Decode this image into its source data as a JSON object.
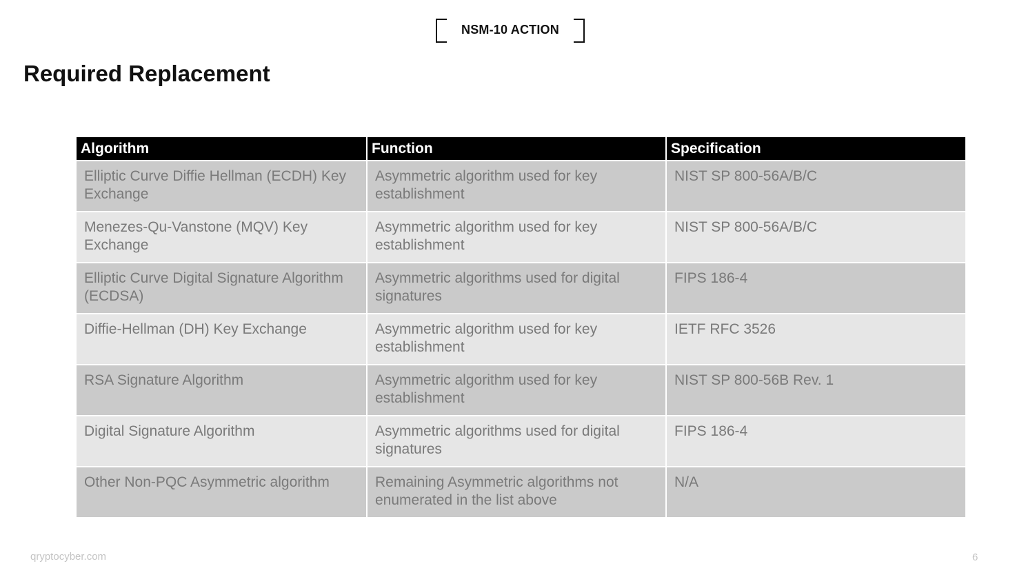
{
  "badge": {
    "label": "NSM-10 ACTION"
  },
  "page": {
    "title": "Required Replacement"
  },
  "table": {
    "headers": [
      "Algorithm",
      "Function",
      "Specification"
    ],
    "rows": [
      {
        "algorithm": "Elliptic Curve Diffie Hellman (ECDH) Key Exchange",
        "function": "Asymmetric algorithm used for key establishment",
        "specification": "NIST SP 800-56A/B/C"
      },
      {
        "algorithm": "Menezes-Qu-Vanstone (MQV) Key Exchange",
        "function": "Asymmetric algorithm used for key establishment",
        "specification": "NIST SP 800-56A/B/C"
      },
      {
        "algorithm": "Elliptic Curve Digital Signature Algorithm (ECDSA)",
        "function": "Asymmetric algorithms used for digital signatures",
        "specification": "FIPS 186-4"
      },
      {
        "algorithm": "Diffie-Hellman (DH) Key Exchange",
        "function": "Asymmetric algorithm used for key establishment",
        "specification": "IETF RFC 3526"
      },
      {
        "algorithm": "RSA Signature Algorithm",
        "function": "Asymmetric algorithm used for key establishment",
        "specification": "NIST SP 800-56B Rev. 1"
      },
      {
        "algorithm": "Digital Signature Algorithm",
        "function": "Asymmetric algorithms used for digital signatures",
        "specification": "FIPS 186-4"
      },
      {
        "algorithm": "Other Non-PQC Asymmetric algorithm",
        "function": "Remaining Asymmetric algorithms not enumerated in the list above",
        "specification": "N/A"
      }
    ]
  },
  "footer": {
    "website": "qryptocyber.com",
    "page_number": "6"
  }
}
